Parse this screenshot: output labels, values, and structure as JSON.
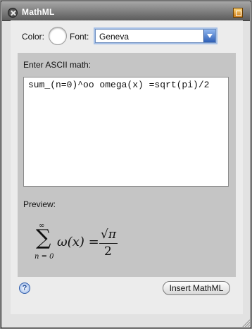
{
  "window": {
    "title": "MathML"
  },
  "controls": {
    "color_label": "Color:",
    "font_label": "Font:",
    "font_value": "Geneva"
  },
  "editor": {
    "ascii_label": "Enter ASCII math:",
    "ascii_text": "sum_(n=0)^oo omega(x) =sqrt(pi)/2",
    "preview_label": "Preview:"
  },
  "preview": {
    "sum_symbol": "∑",
    "sum_upper": "∞",
    "sum_lower": "n = 0",
    "lhs": "ω(x) =",
    "frac_num": "√π",
    "frac_den": "2"
  },
  "buttons": {
    "help_symbol": "?",
    "insert_label": "Insert MathML"
  },
  "colors": {
    "accent": "#3a6fd0"
  }
}
